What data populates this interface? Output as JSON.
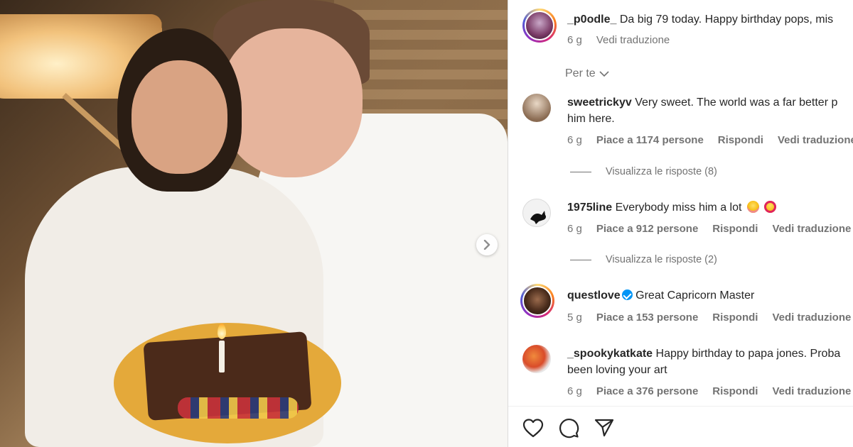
{
  "post": {
    "author": "_p0odle_",
    "caption": "Da big 79 today. Happy birthday pops, mis",
    "age": "6 g",
    "translate": "Vedi traduzione"
  },
  "sort_label": "Per te",
  "comments": [
    {
      "user": "sweetrickyv",
      "text": "Very sweet. The world was a far better p",
      "text_line2": "him here.",
      "age": "6 g",
      "likes": "Piace a 1174 persone",
      "reply": "Rispondi",
      "translate": "Vedi traduzione",
      "view_replies": "Visualizza le risposte (8)"
    },
    {
      "user": "1975line",
      "text": "Everybody miss him a lot",
      "age": "6 g",
      "likes": "Piace a 912 persone",
      "reply": "Rispondi",
      "translate": "Vedi traduzione",
      "view_replies": "Visualizza le risposte (2)"
    },
    {
      "user": "questlove",
      "text": "Great Capricorn Master",
      "age": "5 g",
      "likes": "Piace a 153 persone",
      "reply": "Rispondi",
      "translate": "Vedi traduzione"
    },
    {
      "user": "_spookykatkate",
      "text": "Happy birthday to papa jones. Proba",
      "text_line2": "been loving your art",
      "age": "6 g",
      "likes": "Piace a 376 persone",
      "reply": "Rispondi",
      "translate": "Vedi traduzione"
    }
  ],
  "icons": {
    "like": "heart-icon",
    "comment": "comment-icon",
    "share": "share-icon",
    "next": "chevron-right-icon",
    "sort": "chevron-down-icon",
    "verified": "verified-badge-icon"
  },
  "colors": {
    "verified": "#0095f6",
    "muted_text": "#737373",
    "text": "#262626"
  }
}
